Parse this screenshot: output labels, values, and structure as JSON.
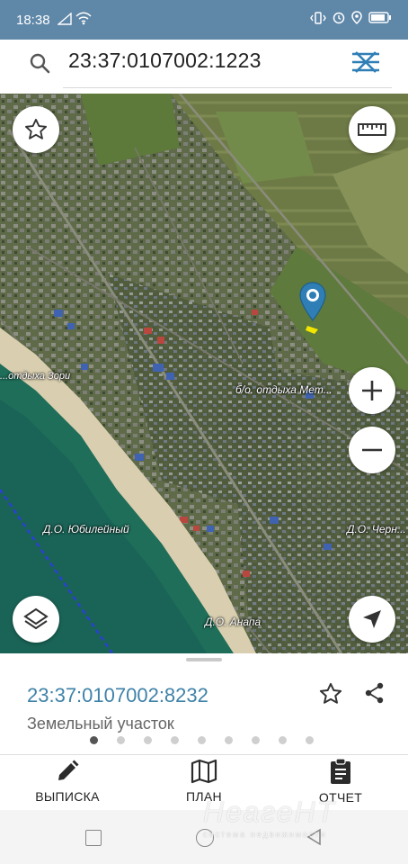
{
  "status_bar": {
    "time": "18:38",
    "icons": [
      "signal-icon",
      "wifi-icon",
      "vibrate-icon",
      "alarm-icon",
      "location-icon",
      "battery-icon"
    ]
  },
  "search": {
    "query": "23:37:0107002:1223",
    "icons": {
      "left": "search-icon",
      "right": "filter-icon"
    }
  },
  "map": {
    "labels": {
      "zori": "...отдыха Зори",
      "met": "б/о. отдыха Мет...",
      "yubileinyi": "Д.О. Юбилейный",
      "cherno": "Д.О. Черн...",
      "anapa": "Д.О. Анапа"
    },
    "controls": [
      "favorite-icon",
      "ruler-icon",
      "zoom-in-icon",
      "zoom-out-icon",
      "layers-icon",
      "my-location-icon"
    ],
    "colors": {
      "sea": "#1f6e5a",
      "beach": "#d9cfb0",
      "land": "#56663d",
      "pin": "#2f7fb6",
      "parcel": "#f2e600"
    }
  },
  "parcel": {
    "number": "23:37:0107002:8232",
    "type": "Земельный участок",
    "page_count": 9,
    "active_page": 1,
    "actions_icons": [
      "star-outline-icon",
      "share-icon"
    ]
  },
  "actions": [
    {
      "label": "ВЫПИСКА",
      "icon": "pencil-icon"
    },
    {
      "label": "ПЛАН",
      "icon": "map-book-icon"
    },
    {
      "label": "ОТЧЕТ",
      "icon": "clipboard-icon"
    }
  ],
  "watermark": {
    "brand": "НеагеНТ",
    "tagline": "системa недвижимости"
  }
}
